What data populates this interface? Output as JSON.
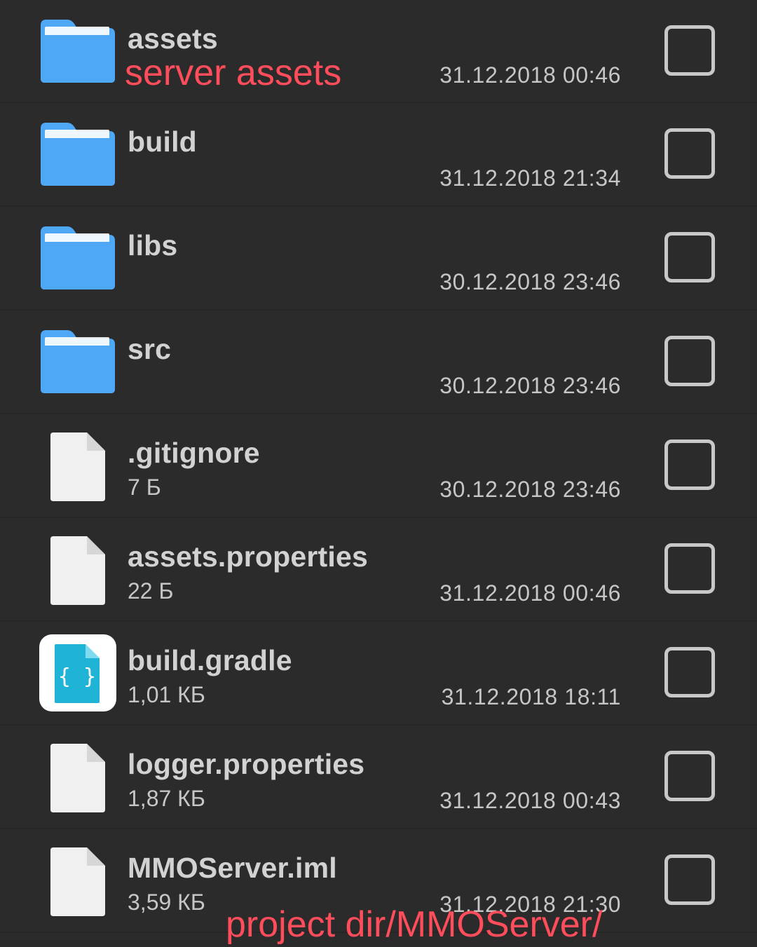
{
  "colors": {
    "background": "#2b2b2b",
    "folder": "#4fa8f5",
    "folder_light": "#8cc8ff",
    "file": "#f0f0f0",
    "gradle_tile": "#ffffff",
    "gradle_doc": "#1fb4d6",
    "annotation": "#ff4d5c"
  },
  "files": [
    {
      "name": "assets",
      "size": "",
      "date": "31.12.2018 00:46",
      "icon": "folder-icon"
    },
    {
      "name": "build",
      "size": "",
      "date": "31.12.2018 21:34",
      "icon": "folder-icon"
    },
    {
      "name": "libs",
      "size": "",
      "date": "30.12.2018 23:46",
      "icon": "folder-icon"
    },
    {
      "name": "src",
      "size": "",
      "date": "30.12.2018 23:46",
      "icon": "folder-icon"
    },
    {
      "name": ".gitignore",
      "size": "7 Б",
      "date": "30.12.2018 23:46",
      "icon": "file-icon"
    },
    {
      "name": "assets.properties",
      "size": "22 Б",
      "date": "31.12.2018 00:46",
      "icon": "file-icon"
    },
    {
      "name": "build.gradle",
      "size": "1,01 КБ",
      "date": "31.12.2018 18:11",
      "icon": "code-file-icon"
    },
    {
      "name": "logger.properties",
      "size": "1,87 КБ",
      "date": "31.12.2018 00:43",
      "icon": "file-icon"
    },
    {
      "name": "MMOServer.iml",
      "size": "3,59 КБ",
      "date": "31.12.2018 21:30",
      "icon": "file-icon"
    }
  ],
  "annotations": {
    "top": "server assets",
    "bottom": "project dir/MMOServer/"
  }
}
